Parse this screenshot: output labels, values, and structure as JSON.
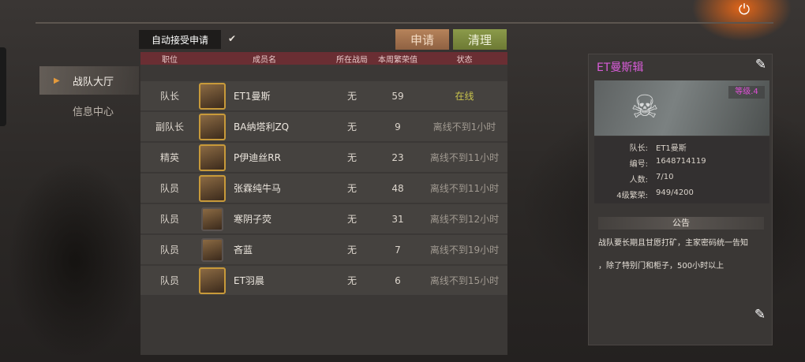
{
  "colors": {
    "header_bar": "#6a2e33",
    "apply_button": "#a5744f",
    "clear_button": "#7f8c3f",
    "online": "#c7c24c",
    "team_name": "#d85cd8",
    "level_badge": "#e04fd8"
  },
  "icons": {
    "power": "power-icon",
    "edit": "edit-icon",
    "nav_arrow": "triangle-right-icon",
    "check": "checkmark-icon",
    "emblem": "skull-emblem"
  },
  "nav": {
    "items": [
      {
        "label": "战队大厅",
        "active": true
      },
      {
        "label": "信息中心",
        "active": false
      }
    ]
  },
  "toolbar": {
    "auto_accept_label": "自动接受申请",
    "auto_accept_checked": true,
    "apply_label": "申请",
    "clear_label": "清理"
  },
  "table": {
    "headers": {
      "position": "职位",
      "name": "成员名",
      "game": "所在战局",
      "prosperity": "本周繁荣值",
      "status": "状态"
    },
    "rows": [
      {
        "position": "队长",
        "name": "ET1曼斯",
        "game": "无",
        "prosperity": "59",
        "status": "在线",
        "online": true
      },
      {
        "position": "副队长",
        "name": "BA纳塔利ZQ",
        "game": "无",
        "prosperity": "9",
        "status": "离线不到1小时",
        "online": false
      },
      {
        "position": "精英",
        "name": "P伊迪丝RR",
        "game": "无",
        "prosperity": "23",
        "status": "离线不到11小时",
        "online": false
      },
      {
        "position": "队员",
        "name": "张霖纯牛马",
        "game": "无",
        "prosperity": "48",
        "status": "离线不到11小时",
        "online": false
      },
      {
        "position": "队员",
        "name": "寒阴子荧",
        "game": "无",
        "prosperity": "31",
        "status": "离线不到12小时",
        "online": false
      },
      {
        "position": "队员",
        "name": "吝蓝",
        "game": "无",
        "prosperity": "7",
        "status": "离线不到19小时",
        "online": false
      },
      {
        "position": "队员",
        "name": "ET羽晨",
        "game": "无",
        "prosperity": "6",
        "status": "离线不到15小时",
        "online": false
      }
    ]
  },
  "team": {
    "name": "ET曼斯辑",
    "level_badge": "等级.4",
    "leader_label": "队长:",
    "leader_value": "ET1曼斯",
    "id_label": "编号:",
    "id_value": "1648714119",
    "count_label": "人数:",
    "count_value": "7/10",
    "prosperity_label": "4级繁荣:",
    "prosperity_value": "949/4200",
    "notice_title": "公告",
    "notice_line1": "战队要长期且甘愿打矿，主家密码统一告知",
    "notice_line2": "，除了特别门和柜子，500小时以上"
  }
}
